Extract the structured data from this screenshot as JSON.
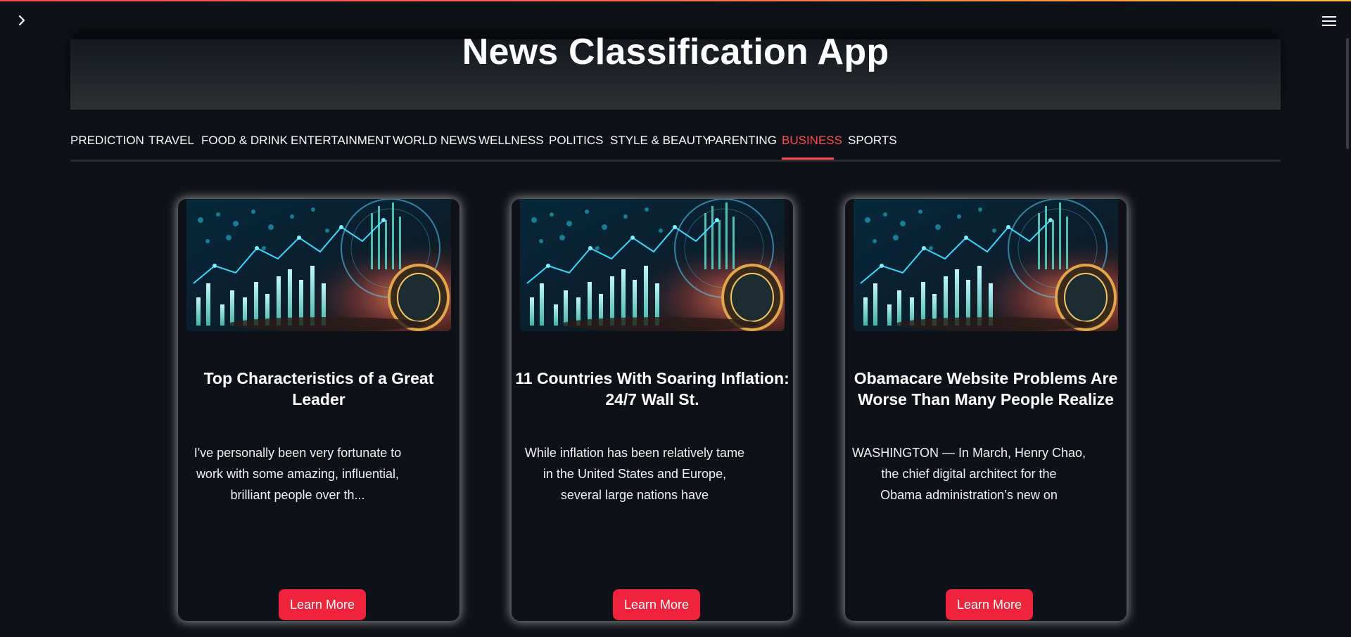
{
  "app": {
    "title": "News Classification App"
  },
  "tabs": [
    {
      "label": "PREDICTION"
    },
    {
      "label": "TRAVEL"
    },
    {
      "label": "FOOD & DRINK"
    },
    {
      "label": "ENTERTAINMENT"
    },
    {
      "label": "WORLD NEWS"
    },
    {
      "label": "WELLNESS"
    },
    {
      "label": "POLITICS"
    },
    {
      "label": "STYLE & BEAUTY"
    },
    {
      "label": "PARENTING"
    },
    {
      "label": "BUSINESS"
    },
    {
      "label": "SPORTS"
    }
  ],
  "active_tab": "BUSINESS",
  "cards": [
    {
      "title_line1": "Top Characteristics of a Great",
      "title_line2": "Leader",
      "summary_line1": "I've personally been very fortunate to",
      "summary_line2": "work with some amazing, influential,",
      "summary_line3": "brilliant people over th...",
      "button_label": "Learn More"
    },
    {
      "title_line1": "11 Countries With Soaring Inflation:",
      "title_line2": "24/7 Wall St.",
      "summary_line1": "While inflation has been relatively tame",
      "summary_line2": "in the United States and Europe,",
      "summary_line3": "several large nations have",
      "button_label": "Learn More"
    },
    {
      "title_line1": "Obamacare Website Problems Are",
      "title_line2": "Worse Than Many People Realize",
      "summary_line1": "WASHINGTON — In March, Henry Chao,",
      "summary_line2": "the chief digital architect for the",
      "summary_line3": "Obama administration’s new on",
      "button_label": "Learn More"
    }
  ],
  "icons": {
    "sidebar_toggle": "chevron-right-icon",
    "main_menu": "hamburger-menu-icon",
    "card_image": "finance-chart-image"
  },
  "colors": {
    "background": "#0e1117",
    "accent": "#ff4b4b",
    "button": "#ef233c",
    "text": "#fafafa"
  }
}
